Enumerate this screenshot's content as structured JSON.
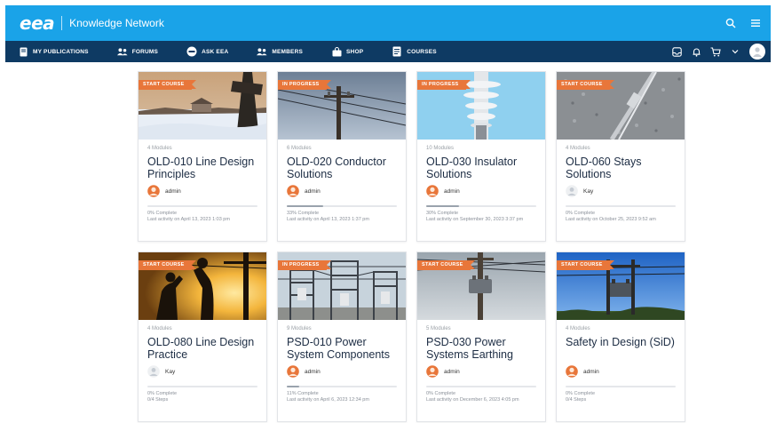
{
  "app": {
    "logo": "eea",
    "name": "Knowledge Network"
  },
  "nav": {
    "items": [
      {
        "label": "MY PUBLICATIONS",
        "icon": "book-icon"
      },
      {
        "label": "FORUMS",
        "icon": "forums-icon"
      },
      {
        "label": "ASK EEA",
        "icon": "ask-eea-icon"
      },
      {
        "label": "MEMBERS",
        "icon": "members-icon"
      },
      {
        "label": "SHOP",
        "icon": "shop-bag-icon"
      },
      {
        "label": "COURSES",
        "icon": "courses-icon"
      }
    ]
  },
  "colors": {
    "topbar": "#1aa3e8",
    "navbar": "#0e3a63",
    "ribbon": "#e8763a",
    "title": "#1d2d44"
  },
  "courses": [
    {
      "status": "START COURSE",
      "modules": "4 Modules",
      "title": "OLD-010 Line Design Principles",
      "author": "admin",
      "author_avatar": "admin-avatar-icon",
      "progress": 0,
      "complete": "0% Complete",
      "activity": "Last activity on April 13, 2023 1:03 pm",
      "image": "snowy-landscape"
    },
    {
      "status": "IN PROGRESS",
      "modules": "6 Modules",
      "title": "OLD-020 Conductor Solutions",
      "author": "admin",
      "author_avatar": "admin-avatar-icon",
      "progress": 0.33,
      "complete": "33% Complete",
      "activity": "Last activity on April 13, 2023 1:37 pm",
      "image": "power-pole-wires"
    },
    {
      "status": "IN PROGRESS",
      "modules": "10 Modules",
      "title": "OLD-030 Insulator Solutions",
      "author": "admin",
      "author_avatar": "admin-avatar-icon",
      "progress": 0.3,
      "complete": "30% Complete",
      "activity": "Last activity on September 30, 2023 3:37 pm",
      "image": "insulator"
    },
    {
      "status": "START COURSE",
      "modules": "4 Modules",
      "title": "OLD-060 Stays Solutions",
      "author": "Kay",
      "author_avatar": "user-placeholder-icon",
      "progress": 0,
      "complete": "0% Complete",
      "activity": "Last activity on October 25, 2023 9:52 am",
      "image": "stay-wire-gravel"
    },
    {
      "status": "START COURSE",
      "modules": "4 Modules",
      "title": "OLD-080 Line Design Practice",
      "author": "Kay",
      "author_avatar": "user-placeholder-icon",
      "progress": 0,
      "complete": "0% Complete",
      "activity": "0/4 Steps",
      "image": "linemen-sunset"
    },
    {
      "status": "IN PROGRESS",
      "modules": "9 Modules",
      "title": "PSD-010 Power System Components",
      "author": "admin",
      "author_avatar": "admin-avatar-icon",
      "progress": 0.11,
      "complete": "11% Complete",
      "activity": "Last activity on April 6, 2023 12:34 pm",
      "image": "substation"
    },
    {
      "status": "START COURSE",
      "modules": "5 Modules",
      "title": "PSD-030 Power Systems Earthing",
      "author": "admin",
      "author_avatar": "admin-avatar-icon",
      "progress": 0,
      "complete": "0% Complete",
      "activity": "Last activity on December 6, 2023 4:05 pm",
      "image": "pole-transformer"
    },
    {
      "status": "START COURSE",
      "modules": "4 Modules",
      "title": "Safety in Design (SiD)",
      "author": "admin",
      "author_avatar": "admin-avatar-icon",
      "progress": 0,
      "complete": "0% Complete",
      "activity": "0/4 Steps",
      "image": "pole-blue-sky"
    }
  ]
}
